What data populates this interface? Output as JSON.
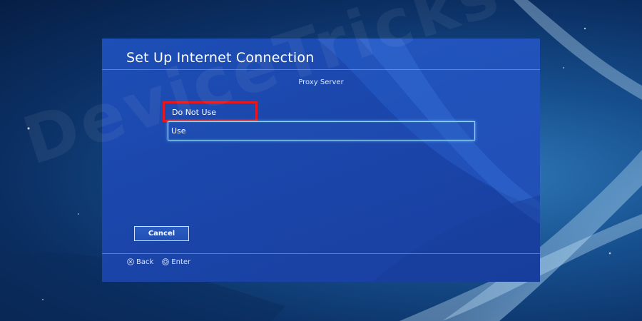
{
  "dialog": {
    "title": "Set Up Internet Connection",
    "section_label": "Proxy Server",
    "options": [
      {
        "label": "Do Not Use"
      },
      {
        "label": "Use"
      }
    ],
    "cancel_label": "Cancel"
  },
  "footer": {
    "back_label": "Back",
    "enter_label": "Enter"
  },
  "watermark": "DeviceTricks",
  "icons": {
    "back": "cross-button-icon",
    "enter": "circle-button-icon"
  },
  "colors": {
    "highlight_border": "#e3191f",
    "focus_border": "#8fd6ff",
    "dialog_bg": "#1d4fb6"
  }
}
